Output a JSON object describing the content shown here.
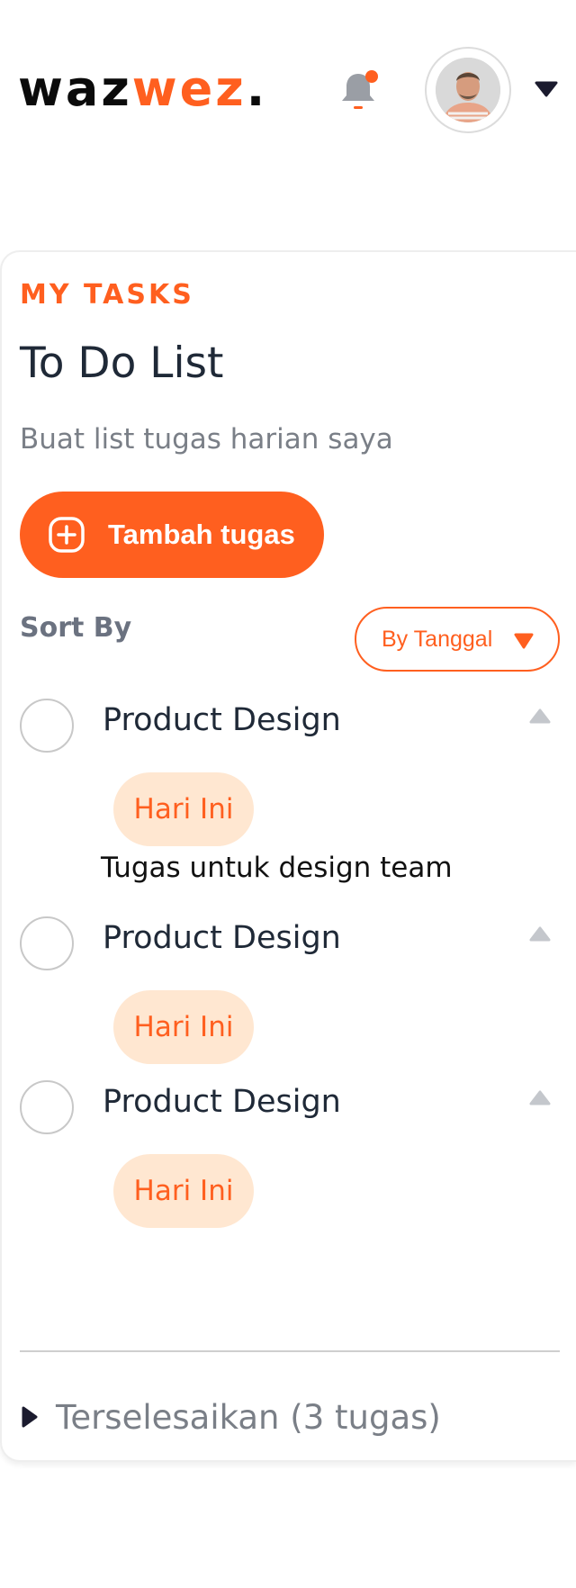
{
  "header": {
    "logo": {
      "part1": "waz",
      "part2": "wez",
      "part3": "."
    },
    "notification_dot": true
  },
  "colors": {
    "accent": "#ff5f1f",
    "badge_bg": "#ffe7d1",
    "muted": "#7a7f87"
  },
  "card": {
    "eyebrow": "MY TASKS",
    "title": "To Do List",
    "subtitle": "Buat list tugas harian saya",
    "add_button_label": "Tambah tugas",
    "sort_label": "Sort By",
    "sort_value": "By Tanggal"
  },
  "tasks": [
    {
      "name": "Product Design",
      "badge": "Hari Ini",
      "description": "Tugas untuk design team"
    },
    {
      "name": "Product Design",
      "badge": "Hari Ini"
    },
    {
      "name": "Product Design",
      "badge": "Hari Ini"
    }
  ],
  "completed": {
    "label": "Terselesaikan (3 tugas)"
  },
  "icons": [
    "bell-icon",
    "avatar",
    "chevron-down-icon",
    "plus-circle-icon",
    "caret-down-icon",
    "caret-up-icon",
    "caret-right-icon"
  ]
}
